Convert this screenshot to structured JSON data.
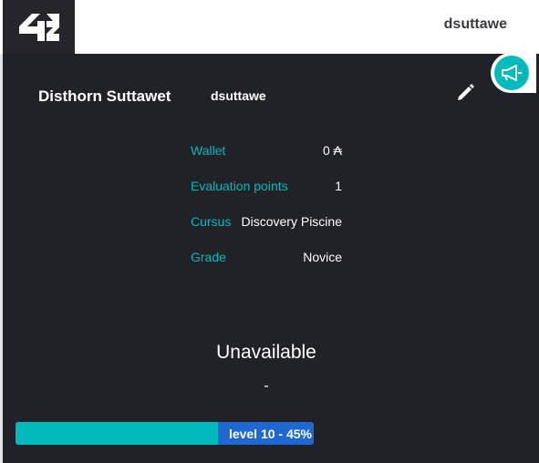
{
  "header": {
    "logo_text": "42",
    "username": "dsuttawe"
  },
  "profile": {
    "full_name": "Disthorn Suttawet",
    "login": "dsuttawe",
    "edit_icon": "pencil-icon",
    "announcement_icon": "megaphone-icon"
  },
  "info": {
    "wallet_label": "Wallet",
    "wallet_value": "0 ₳",
    "evaluation_label": "Evaluation points",
    "evaluation_value": "1",
    "cursus_label": "Cursus",
    "cursus_value": "Discovery Piscine",
    "grade_label": "Grade",
    "grade_value": "Novice"
  },
  "status": {
    "title": "Unavailable",
    "subtitle": "-"
  },
  "level": {
    "text": "level 10 - 45%",
    "progress_percent": 68
  },
  "colors": {
    "panel_bg": "#212128",
    "accent": "#00babc",
    "bar_blue": "#1f67d2"
  }
}
